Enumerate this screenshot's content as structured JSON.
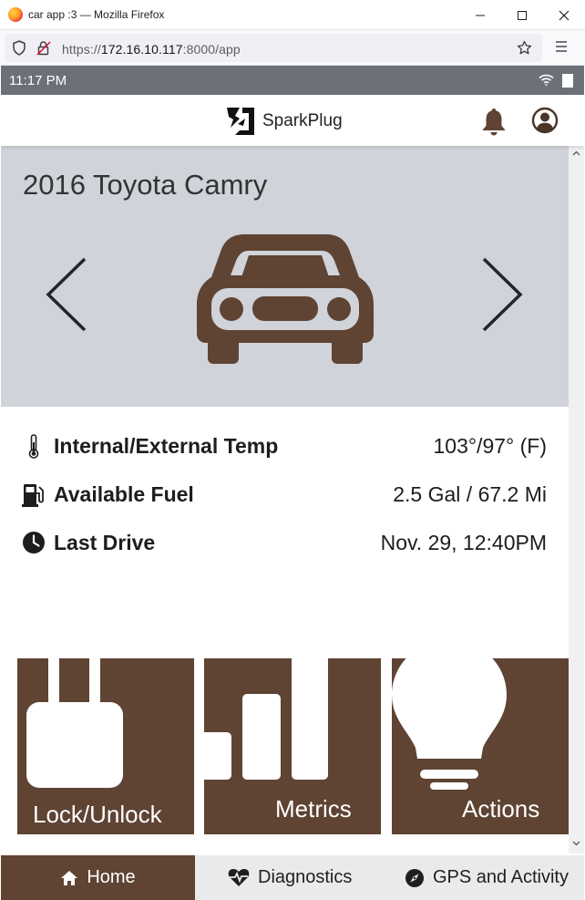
{
  "browser": {
    "window_title": "car app :3 — Mozilla Firefox",
    "url_prefix": "https://",
    "url_host": "172.16.10.117",
    "url_rest": ":8000/app"
  },
  "device": {
    "time": "11:17 PM"
  },
  "header": {
    "brand": "SparkPlug"
  },
  "vehicle": {
    "title": "2016 Toyota Camry"
  },
  "stats": [
    {
      "label": "Internal/External Temp",
      "value": "103°/97° (F)",
      "icon": "thermometer-icon"
    },
    {
      "label": "Available Fuel",
      "value": "2.5 Gal / 67.2 Mi",
      "icon": "fuel-pump-icon"
    },
    {
      "label": "Last Drive",
      "value": "Nov. 29, 12:40PM",
      "icon": "clock-icon"
    }
  ],
  "tiles": [
    {
      "label": "Lock/Unlock",
      "icon": "padlock-icon"
    },
    {
      "label": "Metrics",
      "icon": "bar-chart-icon"
    },
    {
      "label": "Actions",
      "icon": "lightbulb-icon"
    }
  ],
  "bottom_nav": [
    {
      "label": "Home",
      "icon": "home-icon",
      "active": true
    },
    {
      "label": "Diagnostics",
      "icon": "heartbeat-icon",
      "active": false
    },
    {
      "label": "GPS and Activity",
      "icon": "compass-icon",
      "active": false
    }
  ],
  "colors": {
    "accent_brown": "#5f4333",
    "hero_bg": "#d0d3d9",
    "status_bar": "#6b7177"
  }
}
